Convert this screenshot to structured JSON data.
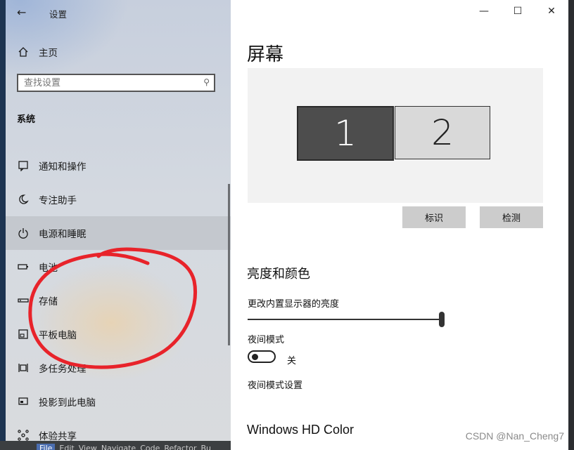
{
  "window": {
    "title": "设置",
    "controls": {
      "minimize": "—",
      "maximize": "☐",
      "close": "✕"
    }
  },
  "sidebar": {
    "home_label": "主页",
    "search_placeholder": "查找设置",
    "section_title": "系统",
    "items": [
      {
        "label": "通知和操作",
        "icon": "notification-icon"
      },
      {
        "label": "专注助手",
        "icon": "moon-icon"
      },
      {
        "label": "电源和睡眠",
        "icon": "power-icon"
      },
      {
        "label": "电池",
        "icon": "battery-icon"
      },
      {
        "label": "存储",
        "icon": "storage-icon"
      },
      {
        "label": "平板电脑",
        "icon": "tablet-icon"
      },
      {
        "label": "多任务处理",
        "icon": "multitask-icon"
      },
      {
        "label": "投影到此电脑",
        "icon": "project-icon"
      },
      {
        "label": "体验共享",
        "icon": "share-icon"
      }
    ]
  },
  "main": {
    "page_title": "屏幕",
    "monitors": [
      "1",
      "2"
    ],
    "identify_button": "标识",
    "detect_button": "检测",
    "brightness_section": "亮度和颜色",
    "brightness_label": "更改内置显示器的亮度",
    "brightness_level": 1.0,
    "night_mode_label": "夜间模式",
    "night_mode_state": "关",
    "night_mode_settings_link": "夜间模式设置",
    "hd_color_title": "Windows HD Color"
  },
  "ide_menu": [
    "File",
    "Edit",
    "View",
    "Navigate",
    "Code",
    "Refactor",
    "Bu"
  ],
  "watermark": "CSDN @Nan_Cheng7",
  "colors": {
    "annotation": "#e8232a",
    "slider": "#333333",
    "monitor_active": "#4d4d4d"
  }
}
